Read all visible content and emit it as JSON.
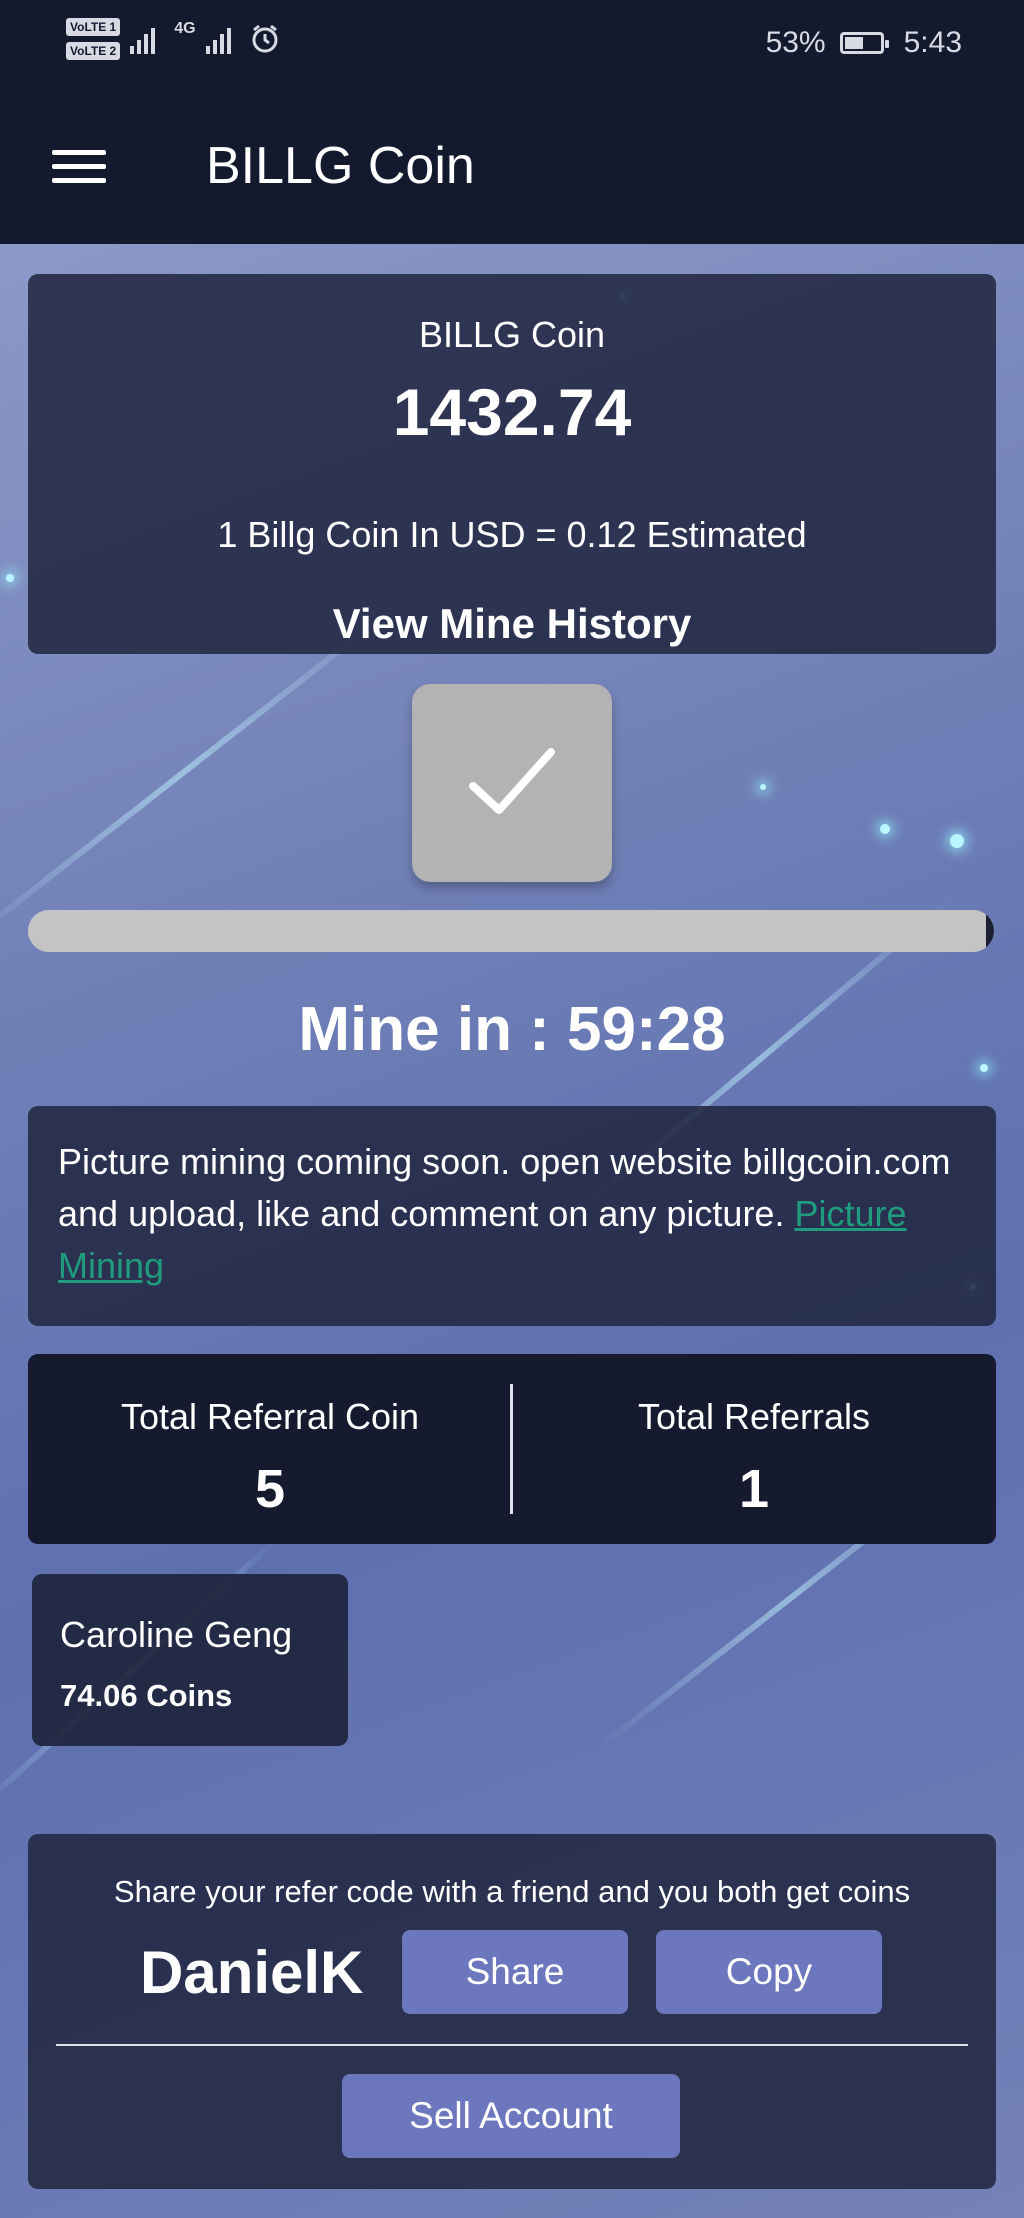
{
  "status_bar": {
    "volte1": "VoLTE 1",
    "volte2": "VoLTE 2",
    "network": "4G",
    "battery": "53%",
    "battery_level": 0.53,
    "time": "5:43"
  },
  "app_bar": {
    "title": "BILLG Coin"
  },
  "balance": {
    "title": "BILLG Coin",
    "amount": "1432.74",
    "rate": "1 Billg Coin In USD = 0.12 Estimated",
    "history_link": "View Mine History"
  },
  "mining": {
    "progress": 0.99,
    "countdown": "Mine in : 59:28"
  },
  "info": {
    "text": "Picture mining coming soon. open website billgcoin.com and upload, like and comment on any picture. ",
    "link": "Picture Mining"
  },
  "stats": {
    "referral_coin_label": "Total Referral Coin",
    "referral_coin_value": "5",
    "referrals_label": "Total Referrals",
    "referrals_value": "1"
  },
  "referral_user": {
    "name": "Caroline Geng",
    "coins": "74.06 Coins"
  },
  "share": {
    "text": "Share your refer code with a friend and you both get coins",
    "code": "DanielK",
    "share_label": "Share",
    "copy_label": "Copy",
    "sell_label": "Sell Account"
  },
  "colors": {
    "header": "#141a2e",
    "button": "#6c77bd",
    "link": "#1f9b7e"
  }
}
